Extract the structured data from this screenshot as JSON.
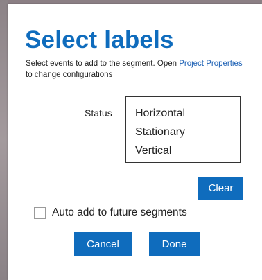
{
  "dialog": {
    "title": "Select labels",
    "description_prefix": "Select events to add to the segment. Open ",
    "description_link": "Project Properties",
    "description_suffix": " to change configurations"
  },
  "status": {
    "label": "Status",
    "options": [
      "Horizontal",
      "Stationary",
      "Vertical"
    ]
  },
  "buttons": {
    "clear": "Clear",
    "cancel": "Cancel",
    "done": "Done"
  },
  "auto_add": {
    "label": "Auto add to future segments",
    "checked": false
  },
  "colors": {
    "accent": "#0f6cbd",
    "link": "#1a5fb4"
  }
}
